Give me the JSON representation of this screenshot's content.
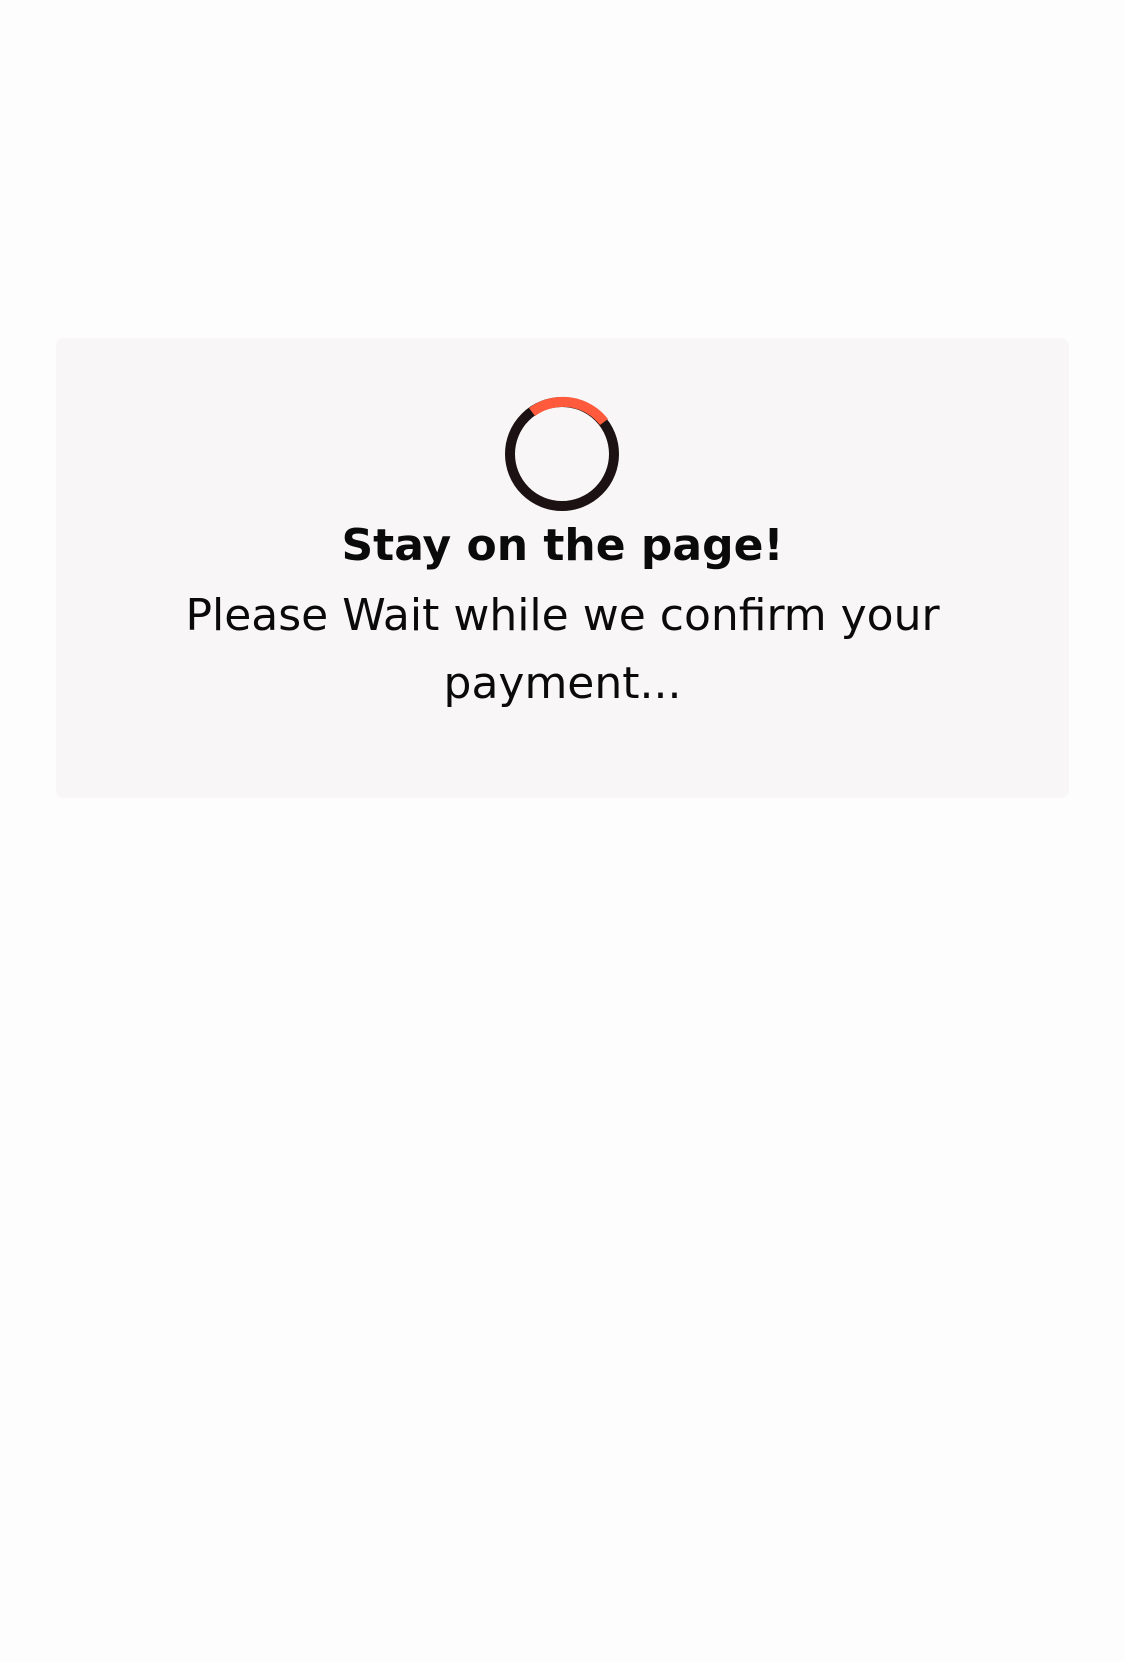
{
  "loading_card": {
    "spinner_icon": "loading-spinner-icon",
    "title": "Stay on the page!",
    "message": "Please Wait while we confirm your payment..."
  },
  "colors": {
    "page_background": "#fdfdfd",
    "card_background": "#f8f6f7",
    "spinner_track": "#1c1213",
    "spinner_accent": "#ff5a3c",
    "text": "#0a0a0a"
  }
}
